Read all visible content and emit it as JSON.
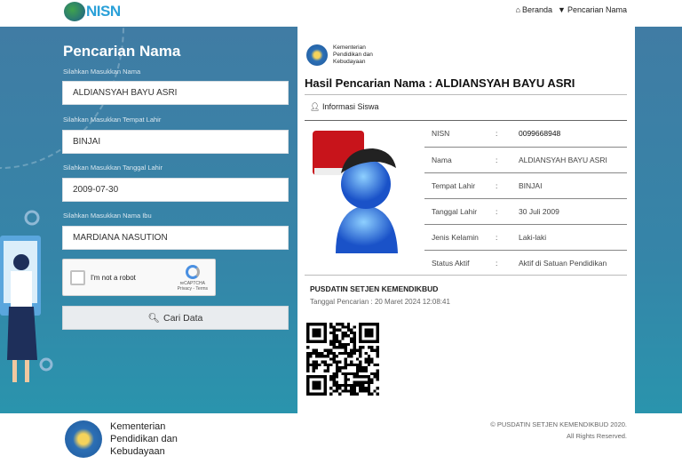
{
  "header": {
    "logo_text": "NISN",
    "nav": [
      {
        "icon": "home-icon",
        "label": "Beranda"
      },
      {
        "icon": "filter-icon",
        "label": "Pencarian Nama"
      }
    ]
  },
  "form": {
    "title": "Pencarian Nama",
    "fields": [
      {
        "label": "Silahkan Masukkan Nama",
        "value": "ALDIANSYAH BAYU ASRI"
      },
      {
        "label": "Silahkan Masukkan Tempat Lahir",
        "value": "BINJAI"
      },
      {
        "label": "Silahkan Masukkan Tanggal Lahir",
        "value": "2009-07-30"
      },
      {
        "label": "Silahkan Masukkan Nama Ibu",
        "value": "MARDIANA NASUTION"
      }
    ],
    "captcha": {
      "label": "I'm not a robot",
      "brand": "reCAPTCHA",
      "links": "Privacy - Terms"
    },
    "submit_label": "Cari Data"
  },
  "result": {
    "ministry": "Kementerian Pendidikan dan Kebudayaan",
    "ministry_lines": [
      "Kementerian",
      "Pendidikan dan",
      "Kebudayaan"
    ],
    "title": "Hasil Pencarian Nama : ALDIANSYAH BAYU ASRI",
    "section": "Informasi Siswa",
    "rows": [
      {
        "label": "NISN",
        "value": "0099668948"
      },
      {
        "label": "Nama",
        "value": "ALDIANSYAH BAYU ASRI"
      },
      {
        "label": "Tempat Lahir",
        "value": "BINJAI"
      },
      {
        "label": "Tanggal Lahir",
        "value": "30 Juli 2009"
      },
      {
        "label": "Jenis Kelamin",
        "value": "Laki-laki"
      },
      {
        "label": "Status Aktif",
        "value": "Aktif di Satuan Pendidikan"
      }
    ],
    "issuer": "PUSDATIN SETJEN KEMENDIKBUD",
    "search_date": "Tanggal Pencarian : 20 Maret 2024 12:08:41"
  },
  "footer": {
    "ministry_lines": [
      "Kementerian",
      "Pendidikan dan",
      "Kebudayaan"
    ],
    "copyright": "© PUSDATIN SETJEN KEMENDIKBUD 2020.",
    "rights": "All Rights Reserved."
  }
}
